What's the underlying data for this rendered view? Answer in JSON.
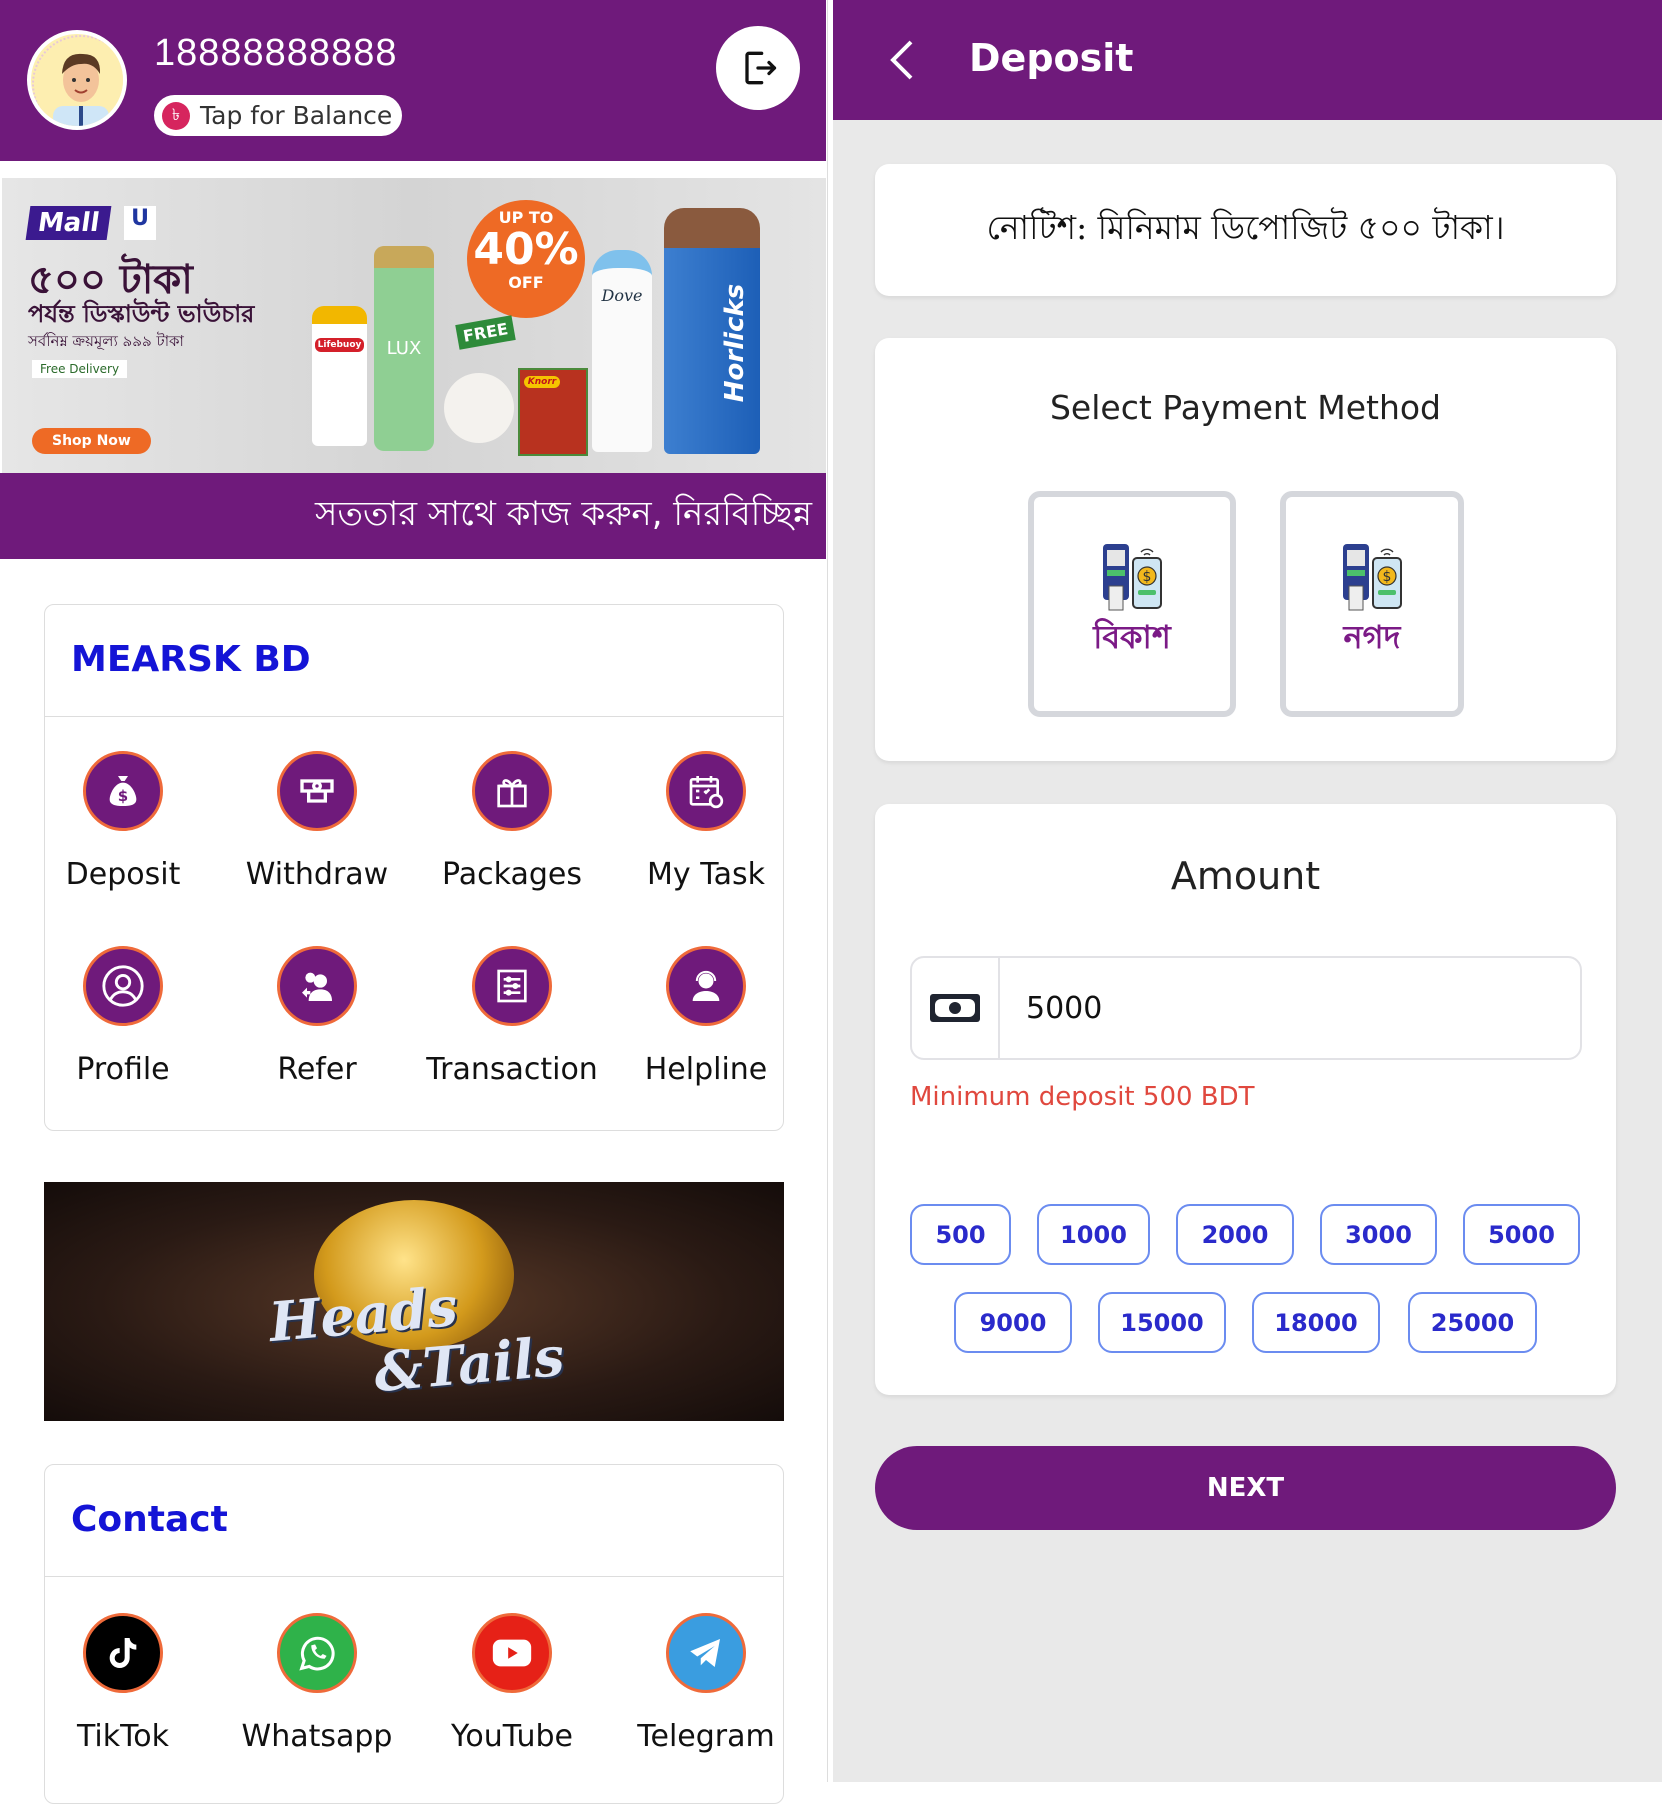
{
  "home": {
    "user": {
      "phone": "18888888888",
      "balance_button": "Tap for Balance",
      "currency_symbol": "৳"
    },
    "banner": {
      "brand": "Mall",
      "headline": "৫০০ টাকা",
      "subhead": "পর্যন্ত ডিস্কাউন্ট ভাউচার",
      "note": "সর্বনিম্ন ক্রয়মূল্য ৯৯৯ টাকা",
      "delivery": "Free Delivery",
      "cta": "Shop Now",
      "badge_top": "UP TO",
      "badge_value": "40%",
      "badge_bottom": "OFF",
      "free_tag": "FREE",
      "products": [
        "Lifebuoy",
        "LUX",
        "Knorr",
        "Dove",
        "Horlicks"
      ]
    },
    "marquee": "সততার সাথে কাজ করুন, নিরবিচ্ছিন্ন",
    "menu_card": {
      "title": "MEARSK BD",
      "items": [
        {
          "label": "Deposit",
          "icon": "money-bag-icon"
        },
        {
          "label": "Withdraw",
          "icon": "atm-withdraw-icon"
        },
        {
          "label": "Packages",
          "icon": "gift-icon"
        },
        {
          "label": "My Task",
          "icon": "calendar-task-icon"
        },
        {
          "label": "Profile",
          "icon": "user-circle-icon"
        },
        {
          "label": "Refer",
          "icon": "refer-users-icon"
        },
        {
          "label": "Transaction",
          "icon": "transaction-list-icon"
        },
        {
          "label": "Helpline",
          "icon": "headset-agent-icon"
        }
      ]
    },
    "game_banner": {
      "line1": "Heads",
      "line2": "&Tails"
    },
    "contact_card": {
      "title": "Contact",
      "items": [
        {
          "label": "TikTok",
          "icon": "tiktok-icon",
          "color": "#000000"
        },
        {
          "label": "Whatsapp",
          "icon": "whatsapp-icon",
          "color": "#2fb24a"
        },
        {
          "label": "YouTube",
          "icon": "youtube-icon",
          "color": "#e62117"
        },
        {
          "label": "Telegram",
          "icon": "telegram-icon",
          "color": "#3a9de0"
        }
      ]
    }
  },
  "deposit": {
    "title": "Deposit",
    "notice": "নোটিশ: মিনিমাম ডিপোজিট ৫০০ টাকা।",
    "payment": {
      "title": "Select Payment Method",
      "methods": [
        {
          "label": "বিকাশ"
        },
        {
          "label": "নগদ"
        }
      ]
    },
    "amount": {
      "title": "Amount",
      "value": "5000",
      "error": "Minimum deposit 500 BDT",
      "presets_row1": [
        "500",
        "1000",
        "2000",
        "3000",
        "5000"
      ],
      "presets_row2": [
        "9000",
        "15000",
        "18000",
        "25000"
      ]
    },
    "next_label": "NEXT"
  },
  "colors": {
    "primary": "#6f1a7b",
    "accent_blue": "#1414d6",
    "error": "#e0483e",
    "chip_border": "#6b8cf0"
  }
}
